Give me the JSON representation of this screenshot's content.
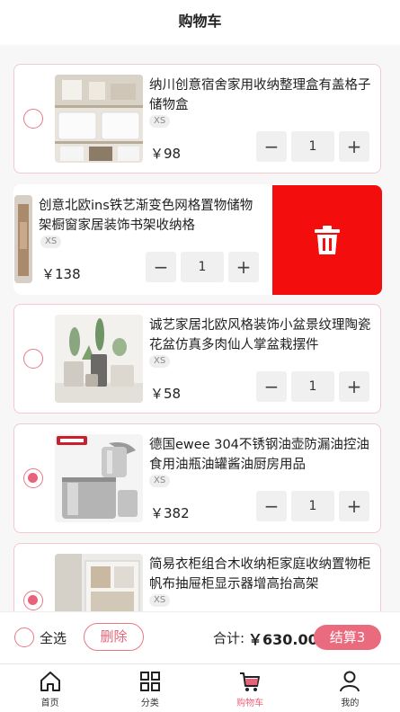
{
  "header": {
    "title": "购物车"
  },
  "items": [
    {
      "title": "纳川创意宿舍家用收纳整理盒有盖格子储物盒",
      "tag": "XS",
      "price": "￥98",
      "qty": "1",
      "checked": false
    },
    {
      "title": "创意北欧ins铁艺渐变色网格置物储物架橱窗家居装饰书架收纳格",
      "tag": "XS",
      "price": "￥138",
      "qty": "1",
      "checked": false
    },
    {
      "title": "诚艺家居北欧风格装饰小盆景纹理陶瓷花盆仿真多肉仙人掌盆栽摆件",
      "tag": "XS",
      "price": "￥58",
      "qty": "1",
      "checked": false
    },
    {
      "title": "德国ewee 304不锈钢油壶防漏油控油食用油瓶油罐酱油厨房用品",
      "tag": "XS",
      "price": "￥382",
      "qty": "1",
      "checked": true
    },
    {
      "title": "简易衣柜组合木收纳柜家庭收纳置物柜帆布抽屉柜显示器增高抬高架",
      "tag": "XS",
      "price": "",
      "qty": "",
      "checked": true
    }
  ],
  "stepper": {
    "minus": "−",
    "plus": "+"
  },
  "footer": {
    "select_all": "全选",
    "delete": "删除",
    "total_label": "合计:",
    "total_value": "￥630.00",
    "checkout": "结算3"
  },
  "tabs": [
    {
      "label": "首页",
      "icon": "home-icon"
    },
    {
      "label": "分类",
      "icon": "grid-icon"
    },
    {
      "label": "购物车",
      "icon": "cart-icon",
      "active": true
    },
    {
      "label": "我的",
      "icon": "user-icon"
    }
  ],
  "colors": {
    "accent": "#e8637a",
    "delete": "#f40d0d",
    "checkout": "#eb6b7e"
  }
}
